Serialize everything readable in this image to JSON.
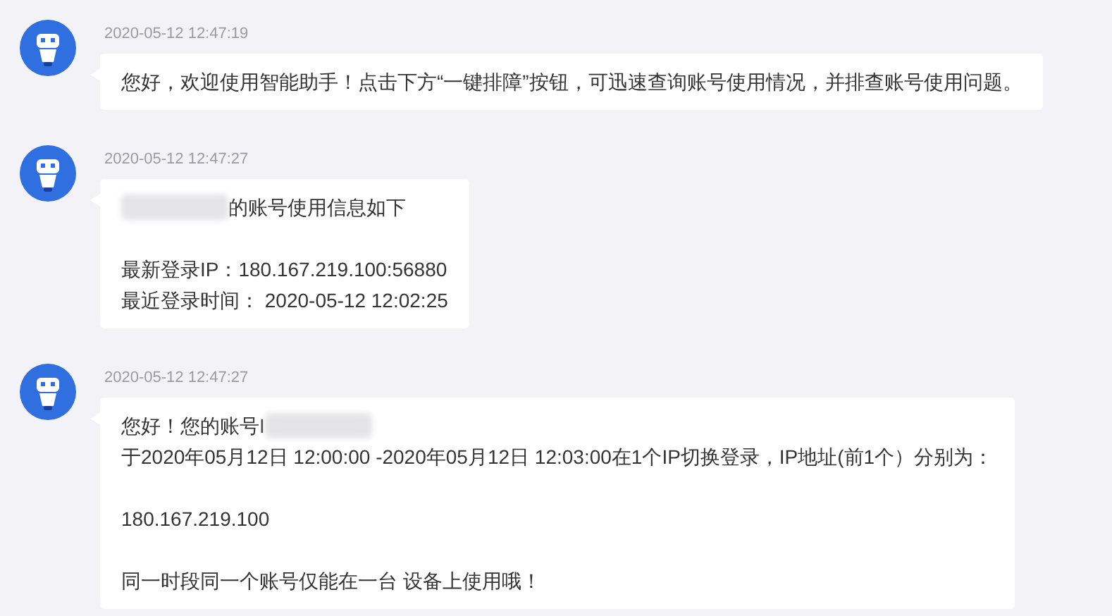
{
  "messages": [
    {
      "time": "2020-05-12 12:47:19",
      "paragraphs": [
        [
          {
            "text": "您好，欢迎使用智能助手！点击下方“一键排障”按钮，可迅速查询账号使用情况，并排查账号使用问题。",
            "redacted_before": false,
            "redacted_after": false
          }
        ]
      ]
    },
    {
      "time": "2020-05-12 12:47:27",
      "paragraphs": [
        [
          {
            "text": "的账号使用信息如下",
            "redacted_before": true,
            "redacted_after": false
          }
        ],
        [
          {
            "text": "最新登录IP：180.167.219.100:56880",
            "redacted_before": false,
            "redacted_after": false
          },
          {
            "text": "最近登录时间：  2020-05-12 12:02:25",
            "redacted_before": false,
            "redacted_after": false
          }
        ]
      ]
    },
    {
      "time": "2020-05-12 12:47:27",
      "paragraphs": [
        [
          {
            "text": "您好！您的账号I",
            "redacted_before": false,
            "redacted_after": true
          },
          {
            "text": "于2020年05月12日 12:00:00 -2020年05月12日 12:03:00在1个IP切换登录，IP地址(前1个）分别为：",
            "redacted_before": false,
            "redacted_after": false
          }
        ],
        [
          {
            "text": "180.167.219.100",
            "redacted_before": false,
            "redacted_after": false
          }
        ],
        [
          {
            "text": "同一时段同一个账号仅能在一台 设备上使用哦！",
            "redacted_before": false,
            "redacted_after": false
          }
        ]
      ]
    }
  ]
}
